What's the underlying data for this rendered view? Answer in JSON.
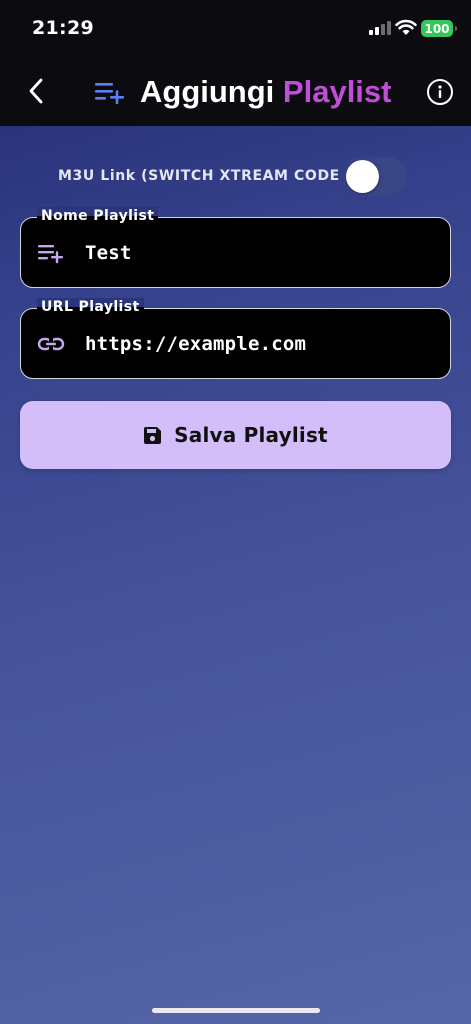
{
  "status_bar": {
    "time": "21:29",
    "battery": "100",
    "battery_color": "#34c759"
  },
  "header": {
    "back_icon": "chevron-left-icon",
    "title_icon": "playlist-add-icon",
    "title_part1": "Aggiungi",
    "title_part2": "Playlist",
    "info_icon": "info-icon",
    "accent_color": "#c04ed8"
  },
  "mode_switch": {
    "label": "M3U Link (SWITCH XTREAM CODE",
    "state": "off"
  },
  "fields": {
    "name": {
      "legend": "Nome Playlist",
      "value": "Test",
      "icon": "playlist-add-icon"
    },
    "url": {
      "legend": "URL Playlist",
      "value": "https://example.com",
      "icon": "link-icon"
    }
  },
  "save_button": {
    "label": "Salva Playlist",
    "icon": "save-icon",
    "color": "#d3befa"
  }
}
